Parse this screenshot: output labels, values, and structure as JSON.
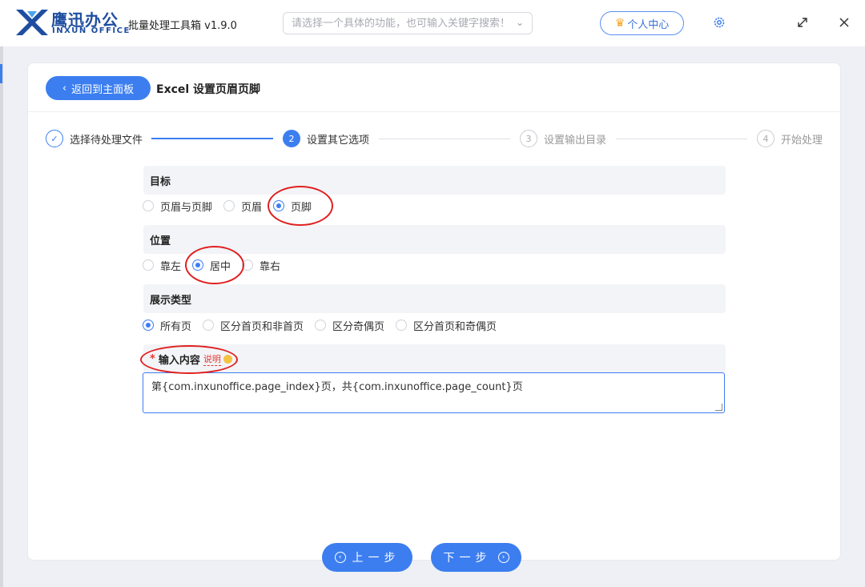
{
  "titlebar": {
    "brand_cn": "鹰迅办公",
    "brand_en": "INXUN OFFICE",
    "app_name": "批量处理工具箱 v1.9.0",
    "search_placeholder": "请选择一个具体的功能，也可输入关键字搜索！",
    "user_center": "个人中心",
    "icons": [
      "settings-gear-icon",
      "maximize-icon",
      "close-icon"
    ]
  },
  "header": {
    "back_label": "返回到主面板",
    "page_title": "Excel 设置页眉页脚"
  },
  "steps": [
    {
      "num": "✓",
      "label": "选择待处理文件",
      "state": "done"
    },
    {
      "num": "2",
      "label": "设置其它选项",
      "state": "active"
    },
    {
      "num": "3",
      "label": "设置输出目录",
      "state": "inactive"
    },
    {
      "num": "4",
      "label": "开始处理",
      "state": "inactive"
    }
  ],
  "target": {
    "title": "目标",
    "options": [
      "页眉与页脚",
      "页眉",
      "页脚"
    ],
    "selected": 2
  },
  "position": {
    "title": "位置",
    "options": [
      "靠左",
      "居中",
      "靠右"
    ],
    "selected": 1
  },
  "display_type": {
    "title": "展示类型",
    "options": [
      "所有页",
      "区分首页和非首页",
      "区分奇偶页",
      "区分首页和奇偶页"
    ],
    "selected": 0
  },
  "input_content": {
    "required_mark": "*",
    "title": "输入内容",
    "help": "说明",
    "value": "第{com.inxunoffice.page_index}页，共{com.inxunoffice.page_count}页"
  },
  "footer": {
    "prev_label": "上一步",
    "next_label": "下一步"
  },
  "colors": {
    "accent": "#3c7ef0",
    "annotation": "#e02020",
    "brand": "#1f4ea0"
  }
}
